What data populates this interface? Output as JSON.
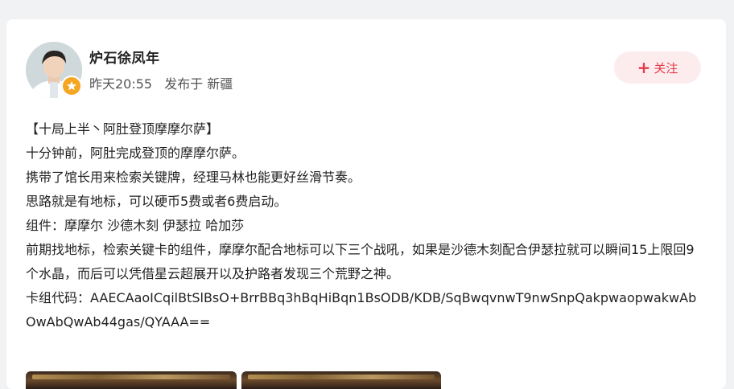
{
  "author": {
    "name": "炉石徐凤年",
    "time": "昨天20:55",
    "published_in": "发布于 新疆"
  },
  "follow": {
    "label": "关注",
    "icon": "plus-icon"
  },
  "post": {
    "lines": [
      "【十局上半丶阿肚登顶摩摩尔萨】",
      "十分钟前，阿肚完成登顶的摩摩尔萨。",
      "携带了馆长用来检索关键牌，经理马林也能更好丝滑节奏。",
      "思路就是有地标，可以硬币5费或者6费启动。",
      "组件：摩摩尔 沙德木刻 伊瑟拉 哈加莎",
      "前期找地标，检索关键卡的组件，摩摩尔配合地标可以下三个战吼，如果是沙德木刻配合伊瑟拉就可以瞬间15上限回9个水晶，而后可以凭借星云超展开以及护路者发现三个荒野之神。",
      "卡组代码：AAECAaoICqilBtSlBsO+BrrBBq3hBqHiBqn1BsODB/KDB/SqBwqvnwT9nwSnpQakpwaopwakwAbOwAbQwAb44gas/QYAAA=="
    ]
  },
  "colors": {
    "accent": "#e6394a",
    "follow_bg": "#fdecee",
    "badge": "#f5a623"
  }
}
